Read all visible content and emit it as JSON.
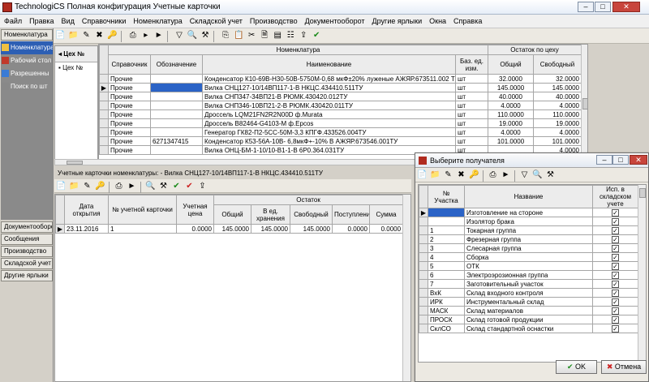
{
  "window": {
    "title": "TechnologiCS Полная конфигурация Учетные карточки"
  },
  "menu": [
    "Файл",
    "Правка",
    "Вид",
    "Справочники",
    "Номенклатура",
    "Складской учет",
    "Производство",
    "Документооборот",
    "Другие ярлыки",
    "Окна",
    "Справка"
  ],
  "left": {
    "top_tab": "Номенклатура",
    "nav": [
      "Номенклатура",
      "Рабочий стол",
      "Разрешенны",
      "Поиск по шт"
    ],
    "bottom_tabs": [
      "Документооборот",
      "Сообщения",
      "Производство",
      "Складской учет",
      "Другие ярлыки"
    ]
  },
  "ceh": {
    "col1": "Цех №",
    "col2": "Цех №"
  },
  "nomen": {
    "group_header": "Номенклатура",
    "stock_header": "Остаток по цеху",
    "cols": [
      "Справочник",
      "Обозначение",
      "Наименование",
      "Баз. ед. изм.",
      "Общий",
      "Свободный"
    ],
    "rows": [
      [
        "Прочие",
        "",
        "Конденсатор К10-69В-Н30-50В-5750М-0,68 мкФ±20% луженые АЖЯР.673511.002 ТУ",
        "шт",
        "32.0000",
        "32.0000"
      ],
      [
        "Прочие",
        "",
        "Вилка СНЦ127-10/14ВП117-1-В НКЦС.434410.511ТУ",
        "шт",
        "145.0000",
        "145.0000"
      ],
      [
        "Прочие",
        "",
        "Вилка СНП347-34ВП21-В РЮМК.430420.012ТУ",
        "шт",
        "40.0000",
        "40.0000"
      ],
      [
        "Прочие",
        "",
        "Вилка СНП346-10ВП21-2-В РЮМК.430420.011ТУ",
        "шт",
        "4.0000",
        "4.0000"
      ],
      [
        "Прочие",
        "",
        "Дроссель LQM21FN2R2N00D ф.Murata",
        "шт",
        "110.0000",
        "110.0000"
      ],
      [
        "Прочие",
        "",
        "Дроссель B82464-G4103-M ф.Epcos",
        "шт",
        "19.0000",
        "19.0000"
      ],
      [
        "Прочие",
        "",
        "Генератор ГК82-П2-5СС-50М-3,3 КПГФ.433526.004ТУ",
        "шт",
        "4.0000",
        "4.0000"
      ],
      [
        "Прочие",
        "6271347415",
        "Конденсатор К53-56А-10В- 6,8мкФ+-10% В АЖЯР.673546.001ТУ",
        "шт",
        "101.0000",
        "101.0000"
      ],
      [
        "Прочие",
        "",
        "Вилка ОНЦ-БМ-1-10/10-В1-1-В 6Р0.364.031ТУ",
        "шт",
        "",
        "4.0000"
      ]
    ]
  },
  "cards": {
    "title": "Учетные карточки номенклатуры: - Вилка СНЦ127-10/14ВП117-1-В НКЦС.434410.511ТУ",
    "group": "Остаток",
    "cols": [
      "Дата открытия",
      "№ учетной карточки",
      "Учетная цена",
      "Общий",
      "В ед. хранения",
      "Свободный",
      "Поступление",
      "Сумма"
    ],
    "rows": [
      [
        "23.11.2016",
        "1",
        "0.0000",
        "145.0000",
        "145.0000",
        "145.0000",
        "0.0000",
        "0.0000"
      ]
    ]
  },
  "dialog": {
    "title": "Выберите получателя",
    "cols": [
      "№ Участка",
      "Название",
      "Исп. в складском учете"
    ],
    "rows": [
      [
        "",
        "Изготовление на стороне"
      ],
      [
        "",
        "Изолятор брака"
      ],
      [
        "1",
        "Токарная группа"
      ],
      [
        "2",
        "Фрезерная группа"
      ],
      [
        "3",
        "Слесарная группа"
      ],
      [
        "4",
        "Сборка"
      ],
      [
        "5",
        "ОТК"
      ],
      [
        "6",
        "Электроэрозионная группа"
      ],
      [
        "7",
        "Заготовительный участок"
      ],
      [
        "ВхК",
        "Склад входного контроля"
      ],
      [
        "ИРК",
        "Инструментальный склад"
      ],
      [
        "МАСК",
        "Склад материалов"
      ],
      [
        "ПРОСК",
        "Склад готовой продукции"
      ],
      [
        "СклСО",
        "Склад стандартной оснастки"
      ]
    ],
    "ok": "OK",
    "cancel": "Отмена"
  }
}
